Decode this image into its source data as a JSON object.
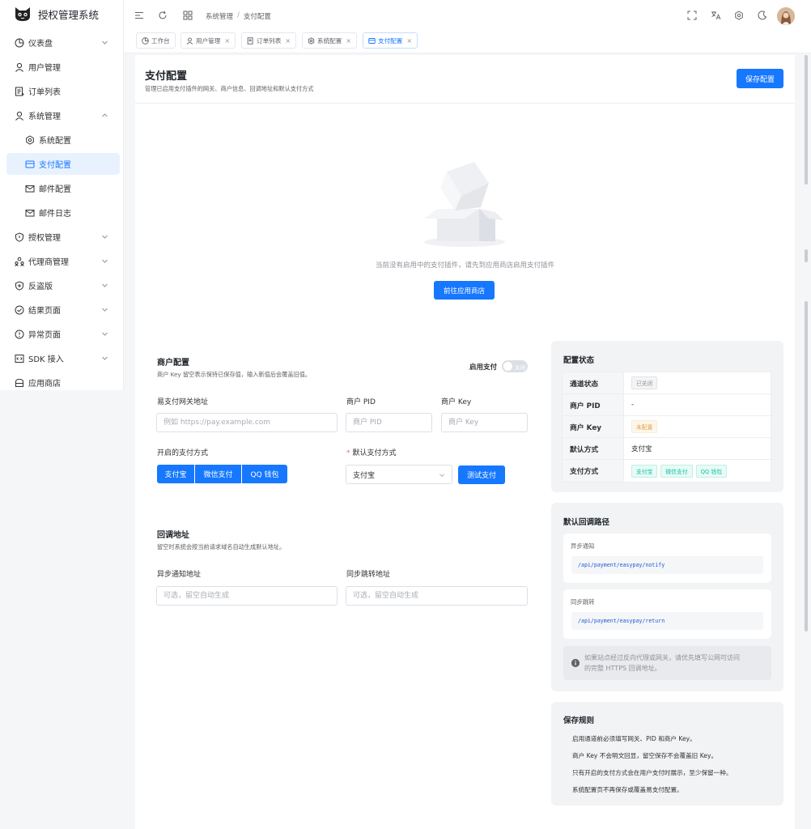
{
  "app": {
    "title": "授权管理系统"
  },
  "sidebar": {
    "items": [
      {
        "label": "仪表盘",
        "icon": "dashboard-icon"
      },
      {
        "label": "用户管理",
        "icon": "user-icon"
      },
      {
        "label": "订单列表",
        "icon": "order-list-icon"
      },
      {
        "label": "系统管理",
        "icon": "user-icon"
      },
      {
        "label": "系统配置",
        "icon": "gear-icon"
      },
      {
        "label": "支付配置",
        "icon": "payment-card-icon"
      },
      {
        "label": "邮件配置",
        "icon": "mail-settings-icon"
      },
      {
        "label": "邮件日志",
        "icon": "mail-icon"
      },
      {
        "label": "授权管理",
        "icon": "shield-icon"
      },
      {
        "label": "代理商管理",
        "icon": "agents-icon"
      },
      {
        "label": "反盗版",
        "icon": "shield-plus-icon"
      },
      {
        "label": "结果页面",
        "icon": "check-circle-icon"
      },
      {
        "label": "异常页面",
        "icon": "alert-circle-icon"
      },
      {
        "label": "SDK 接入",
        "icon": "code-icon"
      },
      {
        "label": "应用商店",
        "icon": "store-icon"
      }
    ]
  },
  "header": {
    "breadcrumb": [
      "系统管理",
      "支付配置"
    ],
    "breadcrumb_sep": "/"
  },
  "tabs": [
    {
      "label": "工作台",
      "closable": false
    },
    {
      "label": "用户管理",
      "closable": true
    },
    {
      "label": "订单列表",
      "closable": true
    },
    {
      "label": "系统配置",
      "closable": true
    },
    {
      "label": "支付配置",
      "closable": true,
      "active": true
    }
  ],
  "tab_close": "×",
  "page": {
    "title": "支付配置",
    "description": "管理已启用支付插件的网关、商户信息、回调地址和默认支付方式",
    "save_label": "保存配置"
  },
  "empty": {
    "message": "当前没有启用中的支付插件，请先到应用商店启用支付插件",
    "button": "前往应用商店"
  },
  "merchant": {
    "title": "商户配置",
    "desc": "商户 Key 留空表示保持已保存值，输入新值后会覆盖旧值。",
    "enable_label": "启用支付",
    "toggle_text": "关闭",
    "gateway_label": "易支付网关地址",
    "gateway_placeholder": "例如 https://pay.example.com",
    "pid_label": "商户 PID",
    "pid_placeholder": "商户 PID",
    "key_label": "商户 Key",
    "key_placeholder": "商户 Key",
    "methods_label": "开启的支付方式",
    "methods": [
      "支付宝",
      "微信支付",
      "QQ 钱包"
    ],
    "default_label": "默认支付方式",
    "required_mark": "*",
    "default_value": "支付宝",
    "test_button": "测试支付"
  },
  "callback": {
    "title": "回调地址",
    "desc": "留空时系统会按当前请求域名自动生成默认地址。",
    "notify_label": "异步通知地址",
    "notify_placeholder": "可选，留空自动生成",
    "return_label": "同步跳转地址",
    "return_placeholder": "可选，留空自动生成"
  },
  "status": {
    "title": "配置状态",
    "rows": [
      {
        "key": "通道状态",
        "tag": "已关闭"
      },
      {
        "key": "商户 PID",
        "value": "-"
      },
      {
        "key": "商户 Key",
        "tag": "未配置"
      },
      {
        "key": "默认方式",
        "value": "支付宝"
      },
      {
        "key": "支付方式",
        "tags": [
          "支付宝",
          "微信支付",
          "QQ 钱包"
        ]
      }
    ]
  },
  "paths": {
    "title": "默认回调路径",
    "notify_label": "异步通知",
    "notify_path": "/api/payment/easypay/notify",
    "return_label": "同步跳转",
    "return_path": "/api/payment/easypay/return",
    "tip_line1": "如果站点经过反向代理或网关，请优先填写公网可访问",
    "tip_line2": "的完整 HTTPS 回调地址。"
  },
  "rules": {
    "title": "保存规则",
    "items": [
      "启用通道前必须填写网关、PID 和商户 Key。",
      "商户 Key 不会明文回显，留空保存不会覆盖旧 Key。",
      "只有开启的支付方式会在用户支付时展示，至少保留一种。",
      "系统配置页不再保存或覆盖易支付配置。"
    ]
  },
  "colors": {
    "primary": "#1677ff",
    "success": "#13c2a3",
    "warning": "#e6a23c"
  }
}
